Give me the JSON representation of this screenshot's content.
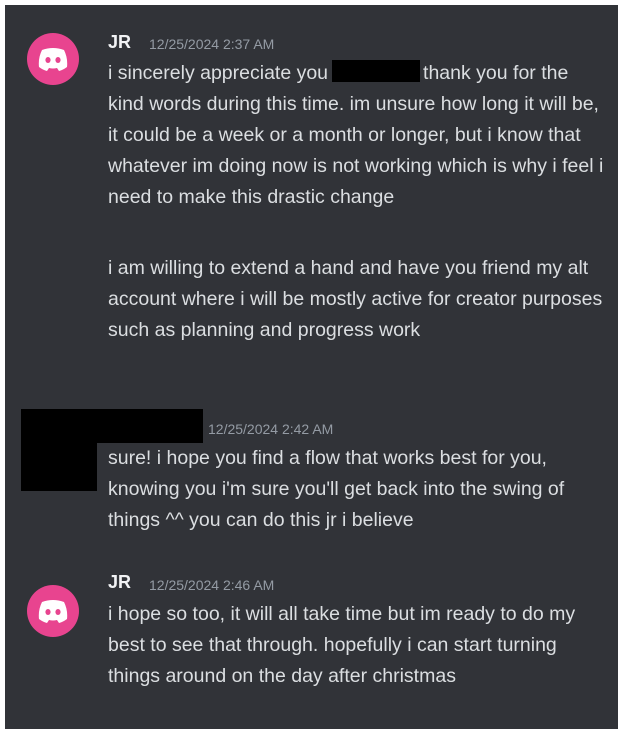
{
  "colors": {
    "background": "#313338",
    "avatar": "#e8448f",
    "username": "#f2f3f5",
    "timestamp": "#949ba4",
    "message_text": "#dbdee1"
  },
  "messages": [
    {
      "avatar_icon": "discord-icon",
      "author": "JR",
      "timestamp": "12/25/2024 2:37 AM",
      "lines": [
        {
          "before_redaction": "i sincerely appreciate you",
          "after_redaction": "thank you for the kind words during this time. im unsure how long it will be, it could be a week or a month or longer, but i know that whatever im doing now is not working which is why i feel i need to make this drastic change"
        },
        {
          "text": "i am willing to extend a hand and have you friend my alt account where i will be mostly active for creator purposes such as planning and progress work"
        }
      ]
    },
    {
      "author": "",
      "timestamp": "12/25/2024 2:42 AM",
      "lines": [
        {
          "text": "sure! i hope you find a flow that works best for you, knowing you i'm sure you'll get back into the swing of things ^^ you can do this jr i believe"
        }
      ]
    },
    {
      "avatar_icon": "discord-icon",
      "author": "JR",
      "timestamp": "12/25/2024 2:46 AM",
      "lines": [
        {
          "text": "i hope so too, it will all take time but im ready to do my best to see that through. hopefully i can start turning things around on the day after christmas"
        }
      ]
    }
  ]
}
